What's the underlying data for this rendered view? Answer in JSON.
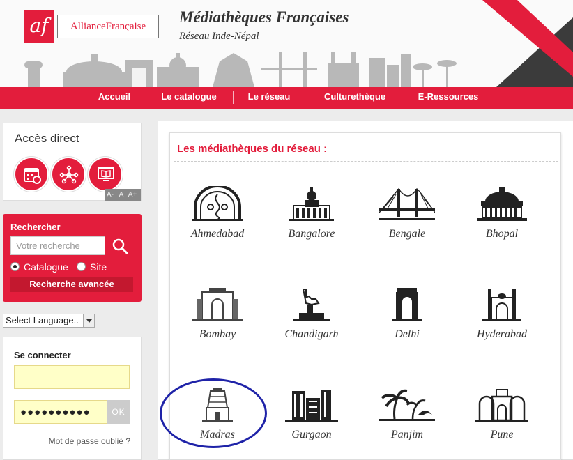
{
  "header": {
    "logo_badge": "af",
    "logo_name": "AllianceFrançaise",
    "title": "Médiathèques Françaises",
    "subtitle": "Réseau Inde-Népal"
  },
  "nav": [
    "Accueil",
    "Le catalogue",
    "Le réseau",
    "Culturethèque",
    "E-Ressources"
  ],
  "acces": {
    "title": "Accès direct",
    "buttons": [
      "calendar-icon",
      "network-icon",
      "book-screen-icon"
    ],
    "font_sizes": [
      "A-",
      "A",
      "A+"
    ]
  },
  "search": {
    "title": "Rechercher",
    "placeholder": "Votre recherche",
    "options": [
      "Catalogue",
      "Site"
    ],
    "selected": "Catalogue",
    "advanced": "Recherche avancée"
  },
  "language": {
    "selected": "Select Language.."
  },
  "login": {
    "title": "Se connecter",
    "username": "",
    "password": "●●●●●●●●●●",
    "ok": "OK",
    "forgot": "Mot de passe oublié ?"
  },
  "network": {
    "title": "Les médiathèques du réseau :",
    "cities": [
      "Ahmedabad",
      "Bangalore",
      "Bengale",
      "Bhopal",
      "Bombay",
      "Chandigarh",
      "Delhi",
      "Hyderabad",
      "Madras",
      "Gurgaon",
      "Panjim",
      "Pune"
    ],
    "highlighted": "Madras"
  },
  "colors": {
    "brand_red": "#e31d3c",
    "annotation_blue": "#1f23a8"
  }
}
